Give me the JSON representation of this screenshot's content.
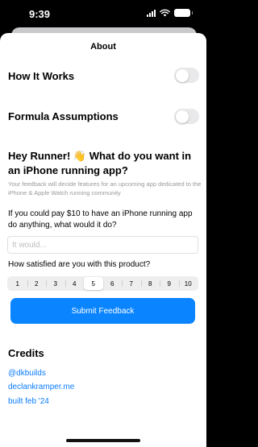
{
  "status_bar": {
    "time": "9:39",
    "icons": [
      "signal-icon",
      "wifi-icon",
      "battery-icon"
    ]
  },
  "sheet": {
    "title": "About"
  },
  "settings": {
    "how_it_works": "How It Works",
    "how_it_works_on": false,
    "formula_assumptions": "Formula Assumptions",
    "formula_assumptions_on": false
  },
  "feedback": {
    "heading": "Hey Runner! 👋 What do you want in an iPhone running app?",
    "description": "Your feedback will decide features for an upcoming app dedicated to the iPhone & Apple Watch running community",
    "question1": "If you could pay $10 to have an iPhone running app do anything, what would it do?",
    "input_placeholder": "It would...",
    "input_value": "",
    "question2": "How satisfied are you with this product?",
    "ratings": [
      "1",
      "2",
      "3",
      "4",
      "5",
      "6",
      "7",
      "8",
      "9",
      "10"
    ],
    "selected_rating": "5",
    "submit_label": "Submit Feedback"
  },
  "credits": {
    "title": "Credits",
    "links": [
      "@dkbuilds",
      "declankramper.me",
      "built feb '24"
    ]
  },
  "colors": {
    "accent": "#0a84ff",
    "link": "#0a7cff",
    "toggle_off": "#e9e9eb"
  }
}
